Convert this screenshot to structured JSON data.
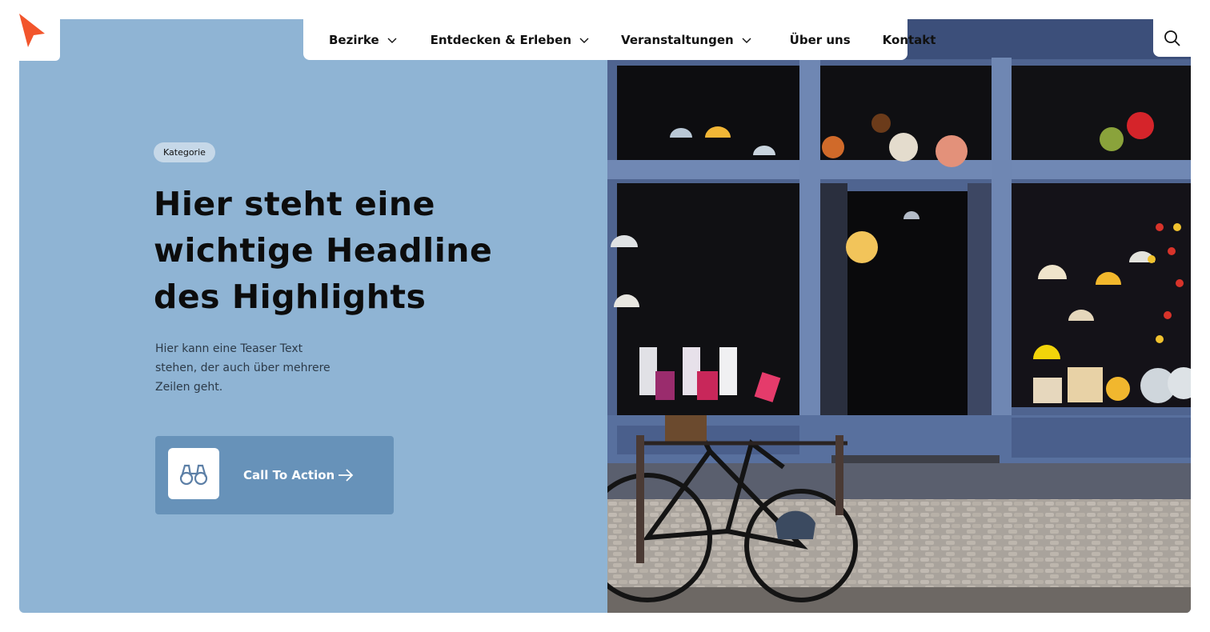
{
  "brand": {
    "logo_icon": "cursor-arrow-icon",
    "accent_color": "#f2552c"
  },
  "nav": {
    "items": [
      {
        "label": "Bezirke",
        "has_dropdown": true
      },
      {
        "label": "Entdecken & Erleben",
        "has_dropdown": true
      },
      {
        "label": "Veranstaltungen",
        "has_dropdown": true
      },
      {
        "label": "Über uns",
        "has_dropdown": false
      },
      {
        "label": "Kontakt",
        "has_dropdown": false
      }
    ],
    "search_icon": "search-icon"
  },
  "hero": {
    "badge": "Kategorie",
    "headline_lines": [
      "Hier steht eine",
      "wichtige Headline",
      "des Highlights"
    ],
    "teaser_lines": [
      "Hier kann eine Teaser Text",
      "stehen, der auch über mehrere",
      "Zeilen geht."
    ],
    "cta": {
      "label": "Call To Action",
      "icon": "binoculars-icon",
      "arrow_icon": "arrow-right-icon"
    },
    "background_color": "#8fb4d4",
    "cta_color": "#6792b9",
    "image_subject": "shop-window-with-lamps-and-bicycle"
  }
}
